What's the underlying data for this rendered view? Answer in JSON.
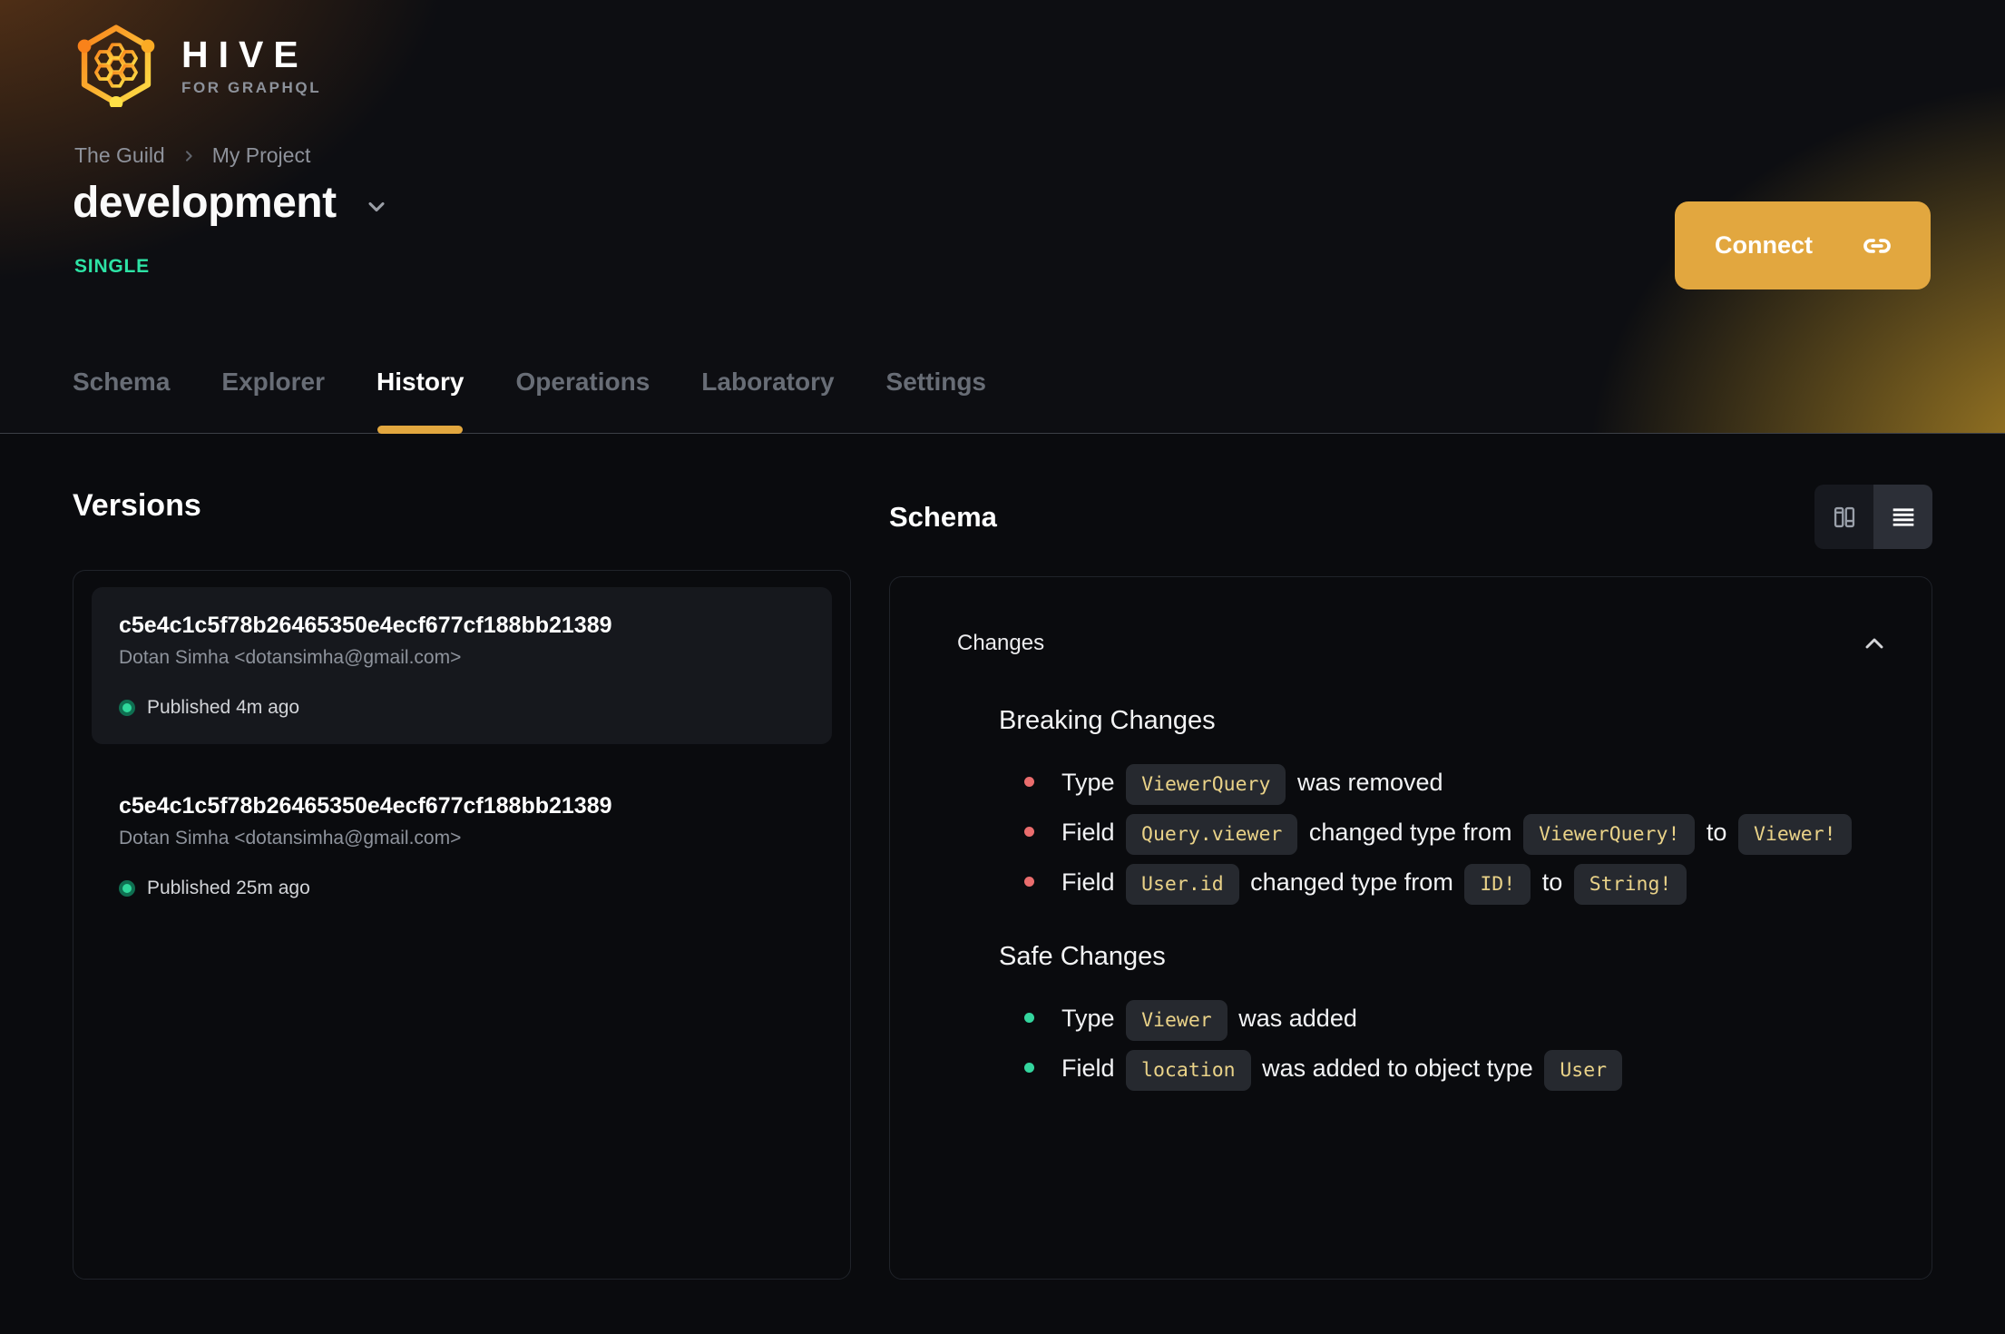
{
  "brand": {
    "name": "HIVE",
    "tagline": "FOR GRAPHQL"
  },
  "breadcrumb": {
    "items": [
      "The Guild",
      "My Project"
    ]
  },
  "project": {
    "title": "development",
    "badge": "SINGLE"
  },
  "header": {
    "connect_label": "Connect"
  },
  "tabs": [
    {
      "label": "Schema",
      "active": false
    },
    {
      "label": "Explorer",
      "active": false
    },
    {
      "label": "History",
      "active": true
    },
    {
      "label": "Operations",
      "active": false
    },
    {
      "label": "Laboratory",
      "active": false
    },
    {
      "label": "Settings",
      "active": false
    }
  ],
  "versions": {
    "title": "Versions",
    "items": [
      {
        "hash": "c5e4c1c5f78b26465350e4ecf677cf188bb21389",
        "author": "Dotan Simha <dotansimha@gmail.com>",
        "status": "Published 4m ago",
        "highlighted": true
      },
      {
        "hash": "c5e4c1c5f78b26465350e4ecf677cf188bb21389",
        "author": "Dotan Simha <dotansimha@gmail.com>",
        "status": "Published 25m ago",
        "highlighted": false
      }
    ]
  },
  "schema": {
    "title": "Schema",
    "view_toggle": {
      "options": [
        "columns-view",
        "list-view"
      ],
      "active": "list-view"
    },
    "changes": {
      "label": "Changes",
      "sections": [
        {
          "title": "Breaking Changes",
          "severity": "breaking",
          "items": [
            [
              {
                "text": "Type"
              },
              {
                "code": "ViewerQuery"
              },
              {
                "text": "was removed"
              }
            ],
            [
              {
                "text": "Field"
              },
              {
                "code": "Query.viewer"
              },
              {
                "text": "changed type from"
              },
              {
                "code": "ViewerQuery!"
              },
              {
                "text": "to"
              },
              {
                "code": "Viewer!"
              }
            ],
            [
              {
                "text": "Field"
              },
              {
                "code": "User.id"
              },
              {
                "text": "changed type from"
              },
              {
                "code": "ID!"
              },
              {
                "text": "to"
              },
              {
                "code": "String!"
              }
            ]
          ]
        },
        {
          "title": "Safe Changes",
          "severity": "safe",
          "items": [
            [
              {
                "text": "Type"
              },
              {
                "code": "Viewer"
              },
              {
                "text": "was added"
              }
            ],
            [
              {
                "text": "Field"
              },
              {
                "code": "location"
              },
              {
                "text": "was added to object type"
              },
              {
                "code": "User"
              }
            ]
          ]
        }
      ]
    }
  },
  "colors": {
    "accent": "#e2a73f",
    "badge_green": "#2de3a5",
    "safe_green": "#34d69e",
    "breaking_red": "#ea6d6d",
    "code_yellow": "#e9d288",
    "dot_green": "#2fd89b",
    "dot_ring": "#0f6f51"
  }
}
